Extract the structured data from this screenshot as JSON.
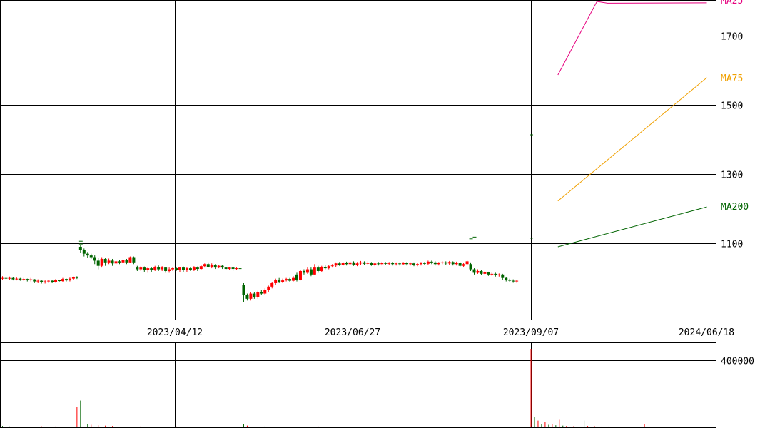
{
  "chart_data": [
    {
      "type": "candlestick",
      "title": "",
      "y_ticks": [
        1100,
        1300,
        1500,
        1700
      ],
      "x_tick_labels": [
        "2023/04/12",
        "2023/06/27",
        "2023/09/07",
        "2024/06/18"
      ],
      "ylim": [
        880,
        1800
      ],
      "grid": true,
      "colors": {
        "up": "#ff0000",
        "down": "#006400",
        "ma25": "#e6007e",
        "ma75": "#f0a000",
        "ma200": "#006400"
      },
      "candles_jan_sep_2023": [
        [
          1,
          1000,
          1000,
          1005,
          995
        ],
        [
          2,
          1000,
          998,
          1003,
          995
        ],
        [
          3,
          998,
          1000,
          1004,
          995
        ],
        [
          4,
          1000,
          996,
          1002,
          993
        ],
        [
          5,
          996,
          998,
          1001,
          993
        ],
        [
          6,
          998,
          995,
          1000,
          992
        ],
        [
          7,
          995,
          997,
          1000,
          992
        ],
        [
          8,
          997,
          994,
          998,
          990
        ],
        [
          9,
          994,
          996,
          1000,
          990
        ],
        [
          10,
          996,
          990,
          997,
          985
        ],
        [
          11,
          990,
          992,
          996,
          985
        ],
        [
          12,
          992,
          988,
          994,
          984
        ],
        [
          13,
          988,
          990,
          993,
          984
        ],
        [
          14,
          990,
          992,
          995,
          986
        ],
        [
          15,
          992,
          989,
          994,
          985
        ],
        [
          16,
          989,
          994,
          997,
          986
        ],
        [
          17,
          994,
          991,
          995,
          987
        ],
        [
          18,
          991,
          997,
          1000,
          988
        ],
        [
          19,
          997,
          993,
          998,
          990
        ],
        [
          20,
          993,
          998,
          1001,
          990
        ],
        [
          21,
          998,
          1002,
          1004,
          995
        ],
        [
          22,
          1002,
          1000,
          1005,
          997
        ],
        [
          23,
          1090,
          1080,
          1095,
          1072
        ],
        [
          24,
          1080,
          1070,
          1085,
          1062
        ],
        [
          25,
          1070,
          1065,
          1075,
          1058
        ],
        [
          26,
          1065,
          1060,
          1070,
          1055
        ],
        [
          27,
          1060,
          1050,
          1065,
          1040
        ],
        [
          28,
          1050,
          1035,
          1058,
          1025
        ],
        [
          29,
          1035,
          1055,
          1060,
          1030
        ],
        [
          30,
          1055,
          1045,
          1058,
          1035
        ],
        [
          31,
          1045,
          1050,
          1056,
          1040
        ],
        [
          32,
          1050,
          1042,
          1055,
          1035
        ],
        [
          33,
          1042,
          1048,
          1052,
          1038
        ],
        [
          34,
          1048,
          1045,
          1051,
          1040
        ],
        [
          35,
          1045,
          1052,
          1056,
          1042
        ],
        [
          36,
          1052,
          1045,
          1055,
          1040
        ],
        [
          37,
          1045,
          1060,
          1062,
          1043
        ],
        [
          38,
          1060,
          1045,
          1062,
          1040
        ],
        [
          39,
          1030,
          1025,
          1035,
          1020
        ],
        [
          40,
          1025,
          1030,
          1034,
          1020
        ],
        [
          41,
          1030,
          1022,
          1033,
          1018
        ],
        [
          42,
          1022,
          1028,
          1032,
          1015
        ],
        [
          43,
          1028,
          1022,
          1031,
          1018
        ],
        [
          44,
          1022,
          1032,
          1035,
          1020
        ],
        [
          45,
          1032,
          1025,
          1036,
          1020
        ],
        [
          46,
          1025,
          1030,
          1034,
          1020
        ],
        [
          47,
          1030,
          1020,
          1032,
          1015
        ],
        [
          48,
          1020,
          1025,
          1030,
          1015
        ],
        [
          49,
          1025,
          1028,
          1030,
          1020
        ],
        [
          50,
          1028,
          1024,
          1031,
          1020
        ],
        [
          51,
          1024,
          1030,
          1032,
          1018
        ],
        [
          52,
          1030,
          1022,
          1033,
          1018
        ],
        [
          53,
          1022,
          1028,
          1031,
          1018
        ],
        [
          54,
          1028,
          1024,
          1032,
          1020
        ],
        [
          55,
          1024,
          1030,
          1034,
          1020
        ],
        [
          56,
          1030,
          1026,
          1033,
          1020
        ],
        [
          57,
          1026,
          1034,
          1037,
          1022
        ],
        [
          58,
          1034,
          1040,
          1042,
          1030
        ],
        [
          59,
          1040,
          1032,
          1045,
          1030
        ],
        [
          60,
          1032,
          1038,
          1042,
          1028
        ],
        [
          61,
          1038,
          1030,
          1040,
          1026
        ],
        [
          62,
          1030,
          1035,
          1037,
          1028
        ],
        [
          63,
          1035,
          1030,
          1037,
          1026
        ],
        [
          64,
          1030,
          1026,
          1032,
          1022
        ],
        [
          65,
          1026,
          1030,
          1032,
          1022
        ],
        [
          66,
          1030,
          1026,
          1033,
          1020
        ],
        [
          67,
          1026,
          1028,
          1030,
          1024
        ],
        [
          68,
          1028,
          1026,
          1030,
          1022
        ],
        [
          69,
          980,
          950,
          985,
          930
        ],
        [
          70,
          950,
          940,
          955,
          935
        ],
        [
          71,
          940,
          955,
          960,
          935
        ],
        [
          72,
          955,
          945,
          960,
          940
        ],
        [
          73,
          945,
          960,
          963,
          940
        ],
        [
          74,
          960,
          955,
          965,
          950
        ],
        [
          75,
          955,
          965,
          970,
          950
        ],
        [
          76,
          965,
          975,
          978,
          960
        ],
        [
          77,
          975,
          985,
          988,
          970
        ],
        [
          78,
          985,
          995,
          998,
          980
        ],
        [
          79,
          995,
          988,
          1000,
          985
        ],
        [
          80,
          988,
          993,
          998,
          985
        ],
        [
          81,
          993,
          997,
          1000,
          990
        ],
        [
          82,
          997,
          992,
          1000,
          988
        ],
        [
          83,
          992,
          1000,
          1005,
          990
        ],
        [
          84,
          1010,
          995,
          1015,
          990
        ],
        [
          85,
          995,
          1020,
          1023,
          993
        ],
        [
          86,
          1020,
          1015,
          1025,
          1010
        ],
        [
          87,
          1015,
          1025,
          1030,
          1012
        ],
        [
          88,
          1025,
          1010,
          1030,
          1005
        ],
        [
          89,
          1010,
          1030,
          1040,
          1008
        ],
        [
          90,
          1030,
          1020,
          1035,
          1015
        ],
        [
          91,
          1020,
          1032,
          1035,
          1018
        ],
        [
          92,
          1032,
          1028,
          1036,
          1025
        ],
        [
          93,
          1028,
          1034,
          1038,
          1025
        ],
        [
          94,
          1034,
          1036,
          1040,
          1030
        ],
        [
          95,
          1036,
          1042,
          1045,
          1032
        ],
        [
          96,
          1042,
          1038,
          1046,
          1035
        ],
        [
          97,
          1038,
          1044,
          1047,
          1035
        ],
        [
          98,
          1044,
          1040,
          1047,
          1036
        ],
        [
          99,
          1040,
          1045,
          1048,
          1037
        ],
        [
          100,
          1045,
          1038,
          1048,
          1035
        ],
        [
          101,
          1038,
          1042,
          1046,
          1034
        ],
        [
          102,
          1042,
          1045,
          1049,
          1038
        ],
        [
          103,
          1045,
          1041,
          1048,
          1037
        ],
        [
          104,
          1041,
          1044,
          1048,
          1038
        ],
        [
          105,
          1044,
          1038,
          1046,
          1035
        ],
        [
          106,
          1038,
          1042,
          1045,
          1034
        ],
        [
          107,
          1042,
          1040,
          1046,
          1036
        ],
        [
          108,
          1040,
          1043,
          1047,
          1036
        ],
        [
          109,
          1043,
          1041,
          1046,
          1037
        ],
        [
          110,
          1041,
          1043,
          1046,
          1037
        ],
        [
          111,
          1043,
          1040,
          1046,
          1036
        ],
        [
          112,
          1040,
          1042,
          1045,
          1036
        ],
        [
          113,
          1042,
          1040,
          1045,
          1036
        ],
        [
          114,
          1040,
          1043,
          1046,
          1037
        ],
        [
          115,
          1043,
          1040,
          1046,
          1036
        ],
        [
          116,
          1040,
          1042,
          1045,
          1036
        ],
        [
          117,
          1042,
          1038,
          1045,
          1034
        ],
        [
          118,
          1038,
          1040,
          1043,
          1034
        ],
        [
          119,
          1040,
          1043,
          1046,
          1036
        ],
        [
          120,
          1043,
          1041,
          1046,
          1037
        ],
        [
          121,
          1041,
          1047,
          1050,
          1038
        ],
        [
          122,
          1047,
          1045,
          1050,
          1040
        ],
        [
          123,
          1045,
          1040,
          1048,
          1036
        ],
        [
          124,
          1040,
          1043,
          1046,
          1036
        ],
        [
          125,
          1043,
          1045,
          1048,
          1040
        ],
        [
          126,
          1045,
          1042,
          1048,
          1038
        ],
        [
          127,
          1042,
          1046,
          1049,
          1038
        ],
        [
          128,
          1046,
          1040,
          1048,
          1036
        ],
        [
          129,
          1040,
          1044,
          1047,
          1036
        ],
        [
          130,
          1044,
          1035,
          1046,
          1032
        ],
        [
          131,
          1035,
          1040,
          1043,
          1032
        ],
        [
          132,
          1040,
          1048,
          1052,
          1036
        ],
        [
          133,
          1040,
          1025,
          1045,
          1020
        ],
        [
          134,
          1025,
          1015,
          1028,
          1010
        ],
        [
          135,
          1015,
          1020,
          1025,
          1012
        ],
        [
          136,
          1020,
          1012,
          1022,
          1008
        ],
        [
          137,
          1012,
          1016,
          1020,
          1010
        ],
        [
          138,
          1016,
          1010,
          1018,
          1006
        ],
        [
          139,
          1010,
          1012,
          1016,
          1006
        ],
        [
          140,
          1012,
          1008,
          1015,
          1004
        ],
        [
          141,
          1008,
          1010,
          1013,
          1004
        ],
        [
          142,
          1010,
          1000,
          1012,
          995
        ],
        [
          143,
          1000,
          995,
          1002,
          990
        ],
        [
          144,
          995,
          992,
          998,
          988
        ],
        [
          145,
          992,
          990,
          996,
          986
        ],
        [
          146,
          990,
          992,
          995,
          986
        ]
      ],
      "candle_ticks": [
        [
          23,
          1098
        ],
        [
          23,
          1106
        ],
        [
          133,
          1113
        ],
        [
          134,
          1118
        ],
        [
          150,
          1115
        ],
        [
          150,
          1413
        ]
      ],
      "ma25": [
        [
          158,
          1586
        ],
        [
          169,
          1798
        ],
        [
          172,
          1793
        ],
        [
          200,
          1794
        ]
      ],
      "ma75": [
        [
          158,
          1222
        ],
        [
          200,
          1578
        ]
      ],
      "ma200": [
        [
          158,
          1090
        ],
        [
          200,
          1205
        ]
      ]
    },
    {
      "type": "bar",
      "title": "",
      "y_ticks": [
        400000
      ],
      "ylim": [
        0,
        470000
      ],
      "up_color": "#ff0000",
      "down_color": "#006400",
      "volume": [
        [
          1,
          8000
        ],
        [
          3,
          5000
        ],
        [
          8,
          4000
        ],
        [
          12,
          6000
        ],
        [
          16,
          5000
        ],
        [
          19,
          4000
        ],
        [
          22,
          120000
        ],
        [
          23,
          160000
        ],
        [
          25,
          20000
        ],
        [
          26,
          15000
        ],
        [
          28,
          12000
        ],
        [
          30,
          10000
        ],
        [
          32,
          8000
        ],
        [
          35,
          5000
        ],
        [
          40,
          6000
        ],
        [
          43,
          4000
        ],
        [
          50,
          5000
        ],
        [
          55,
          4000
        ],
        [
          60,
          4000
        ],
        [
          65,
          3000
        ],
        [
          69,
          20000
        ],
        [
          70,
          10000
        ],
        [
          75,
          5000
        ],
        [
          80,
          4000
        ],
        [
          90,
          5000
        ],
        [
          100,
          3000
        ],
        [
          110,
          3000
        ],
        [
          120,
          3000
        ],
        [
          130,
          3000
        ],
        [
          140,
          3000
        ],
        [
          145,
          4000
        ],
        [
          150,
          470000
        ],
        [
          151,
          60000
        ],
        [
          152,
          40000
        ],
        [
          153,
          20000
        ],
        [
          154,
          30000
        ],
        [
          155,
          15000
        ],
        [
          156,
          20000
        ],
        [
          157,
          12000
        ],
        [
          158,
          45000
        ],
        [
          159,
          10000
        ],
        [
          160,
          8000
        ],
        [
          162,
          6000
        ],
        [
          165,
          40000
        ],
        [
          166,
          8000
        ],
        [
          168,
          6000
        ],
        [
          170,
          5000
        ],
        [
          172,
          5000
        ],
        [
          175,
          4000
        ],
        [
          182,
          20000
        ],
        [
          188,
          3000
        ]
      ]
    }
  ]
}
